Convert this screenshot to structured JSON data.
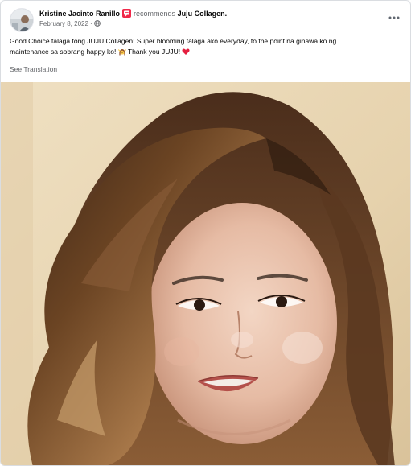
{
  "post": {
    "author": "Kristine Jacinto Ranillo",
    "verb": "recommends",
    "page": "Juju Collagen.",
    "date": "February 8, 2022",
    "separator": "·",
    "text_line_1": "Good Choice talaga tong JUJU Collagen! Super blooming talaga ako everyday, to the point na ginawa ko ng",
    "text_line_2_a": "maintenance sa sobrang happy ko!",
    "text_line_2_b": "Thank you JUJU!",
    "see_translation": "See Translation",
    "icons": {
      "recommend": "recommend-badge-icon",
      "privacy": "globe-icon",
      "more": "more-options-icon",
      "emoji_1": "woman-gesturing-ok-emoji",
      "emoji_2": "red-heart-emoji"
    },
    "colors": {
      "recommend_badge": "#f02849",
      "heart": "#e41e3f",
      "secondary_text": "#65676b",
      "primary_text": "#050505"
    }
  },
  "photo": {
    "alt": "selfie-photo"
  }
}
